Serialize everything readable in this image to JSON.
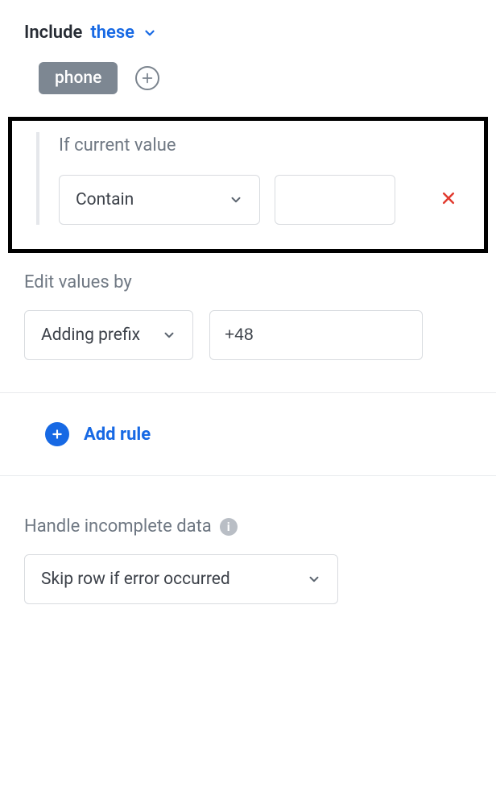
{
  "include": {
    "label": "Include",
    "link": "these"
  },
  "chips": [
    {
      "label": "phone"
    }
  ],
  "condition": {
    "label": "If current value",
    "operator": "Contain",
    "value": ""
  },
  "edit": {
    "label": "Edit values by",
    "mode": "Adding prefix",
    "value": "+48"
  },
  "add_rule": "Add rule",
  "handle": {
    "label": "Handle incomplete data",
    "value": "Skip row if error occurred"
  }
}
